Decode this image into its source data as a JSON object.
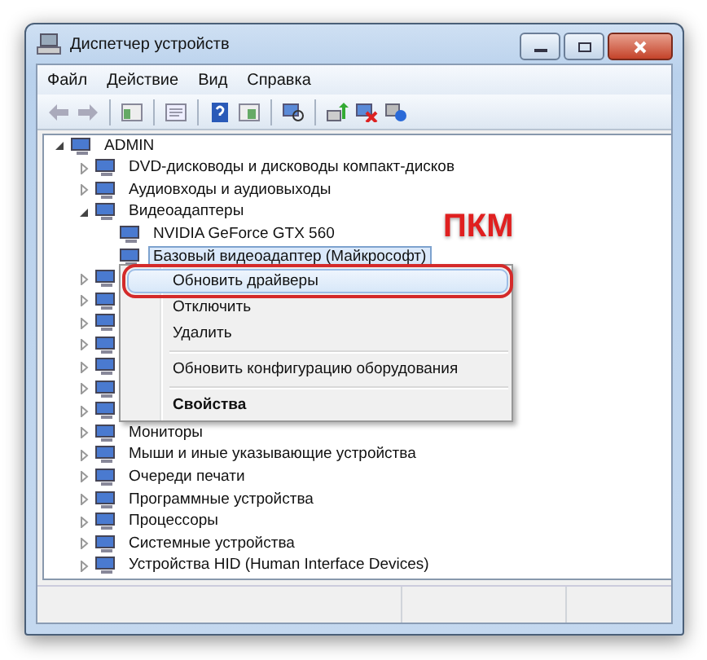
{
  "window": {
    "title": "Диспетчер устройств"
  },
  "menu_bar": [
    {
      "label": "Файл"
    },
    {
      "label": "Действие"
    },
    {
      "label": "Вид"
    },
    {
      "label": "Справка"
    }
  ],
  "tree": {
    "label": "ADMIN",
    "expanded": true,
    "selected": false,
    "children": [
      {
        "label": "DVD-дисководы и дисководы компакт-дисков",
        "expanded": false,
        "selected": false
      },
      {
        "label": "Аудиовходы и аудиовыходы",
        "expanded": false,
        "selected": false
      },
      {
        "label": "Видеоадаптеры",
        "expanded": true,
        "selected": false,
        "children": [
          {
            "label": "NVIDIA GeForce GTX 560",
            "selected": false
          },
          {
            "label": "Базовый видеоадаптер (Майкрософт)",
            "selected": true
          }
        ]
      },
      {
        "expanded": false
      },
      {
        "expanded": false
      },
      {
        "expanded": false
      },
      {
        "expanded": false
      },
      {
        "expanded": false
      },
      {
        "expanded": false
      },
      {
        "expanded": false
      },
      {
        "label": "Мониторы",
        "expanded": false,
        "selected": false
      },
      {
        "label": "Мыши и иные указывающие устройства",
        "expanded": false,
        "selected": false
      },
      {
        "label": "Очереди печати",
        "expanded": false,
        "selected": false
      },
      {
        "label": "Программные устройства",
        "expanded": false,
        "selected": false
      },
      {
        "label": "Процессоры",
        "expanded": false,
        "selected": false
      },
      {
        "label": "Системные устройства",
        "expanded": false,
        "selected": false
      },
      {
        "label": "Устройства HID (Human Interface Devices)",
        "expanded": false,
        "selected": false
      }
    ]
  },
  "context_menu": [
    {
      "kind": "item",
      "label": "Обновить драйверы",
      "selected": true,
      "bold": false,
      "circled": true
    },
    {
      "kind": "item",
      "label": "Отключить",
      "selected": false,
      "bold": false,
      "circled": false
    },
    {
      "kind": "item",
      "label": "Удалить",
      "selected": false,
      "bold": false,
      "circled": false
    },
    {
      "kind": "separator"
    },
    {
      "kind": "item",
      "label": "Обновить конфигурацию оборудования",
      "selected": false,
      "bold": false,
      "circled": false
    },
    {
      "kind": "separator"
    },
    {
      "kind": "item",
      "label": "Свойства",
      "selected": false,
      "bold": true,
      "circled": false
    }
  ],
  "annotation": {
    "text": "ПКМ"
  }
}
